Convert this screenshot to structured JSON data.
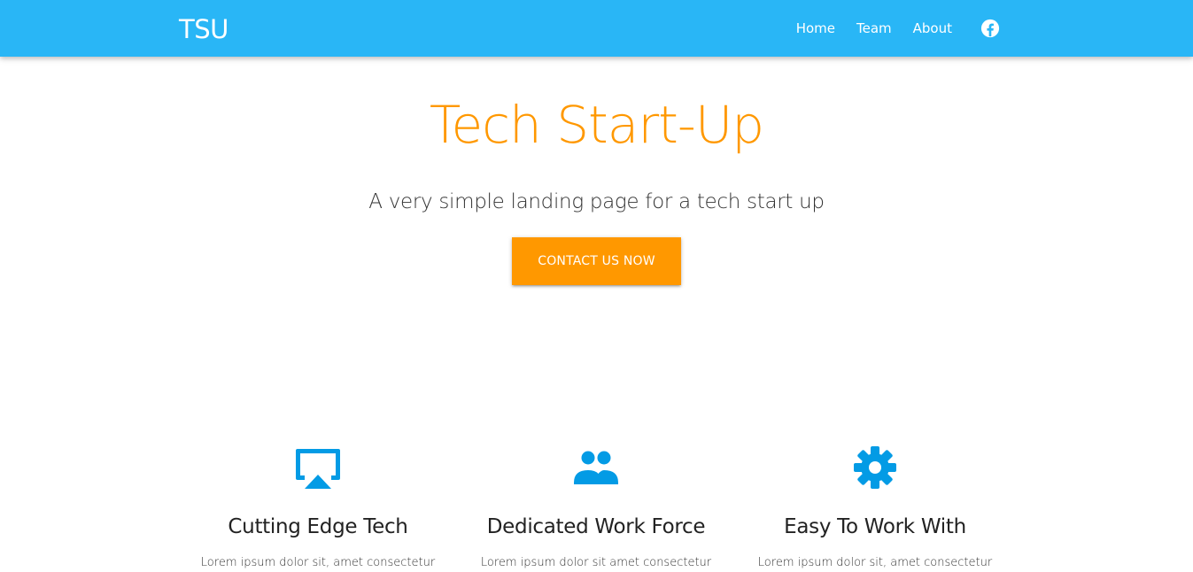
{
  "navbar": {
    "brand": "TSU",
    "links": [
      "Home",
      "Team",
      "About"
    ],
    "social_icon": "facebook-icon",
    "background_color": "#29b6f6"
  },
  "hero": {
    "title": "Tech Start-Up",
    "subtitle": "A very simple landing page for a tech start up",
    "cta_label": "CONTACT US NOW",
    "accent_color": "#ff9800"
  },
  "features": [
    {
      "icon": "airplay-icon",
      "title": "Cutting Edge Tech",
      "text": "Lorem ipsum dolor sit, amet consectetur"
    },
    {
      "icon": "people-icon",
      "title": "Dedicated Work Force",
      "text": "Lorem ipsum dolor sit amet consectetur"
    },
    {
      "icon": "gear-icon",
      "title": "Easy To Work With",
      "text": "Lorem ipsum dolor sit, amet consectetur"
    }
  ],
  "icon_color": "#039be5"
}
